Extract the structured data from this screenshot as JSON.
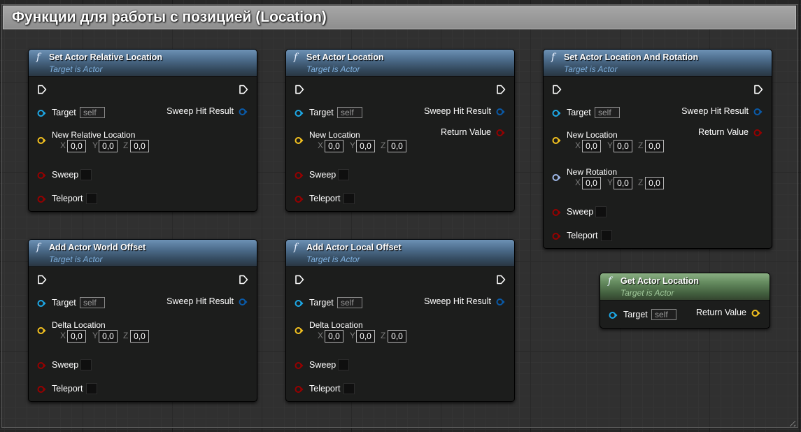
{
  "comment": {
    "title": "Функции для работы с позицией (Location)"
  },
  "colors": {
    "node_header_function": "#4e6e8e",
    "node_header_pure": "#648a5e",
    "pin_object": "#1da8e6",
    "pin_vector": "#f2c01f",
    "pin_rotator": "#9fb8e8",
    "pin_bool": "#960000",
    "pin_struct": "#0a5aa8"
  },
  "nodes": [
    {
      "id": "set-actor-relative-location",
      "title": "Set Actor Relative Location",
      "subtitle": "Target is Actor",
      "inputs": {
        "target": {
          "label": "Target",
          "value": "self"
        },
        "vector": {
          "label": "New Relative Location",
          "x": "0,0",
          "y": "0,0",
          "z": "0,0"
        },
        "sweep": {
          "label": "Sweep",
          "checked": false
        },
        "teleport": {
          "label": "Teleport",
          "checked": false
        }
      },
      "outputs": {
        "sweep_hit": "Sweep Hit Result"
      }
    },
    {
      "id": "set-actor-location",
      "title": "Set Actor Location",
      "subtitle": "Target is Actor",
      "inputs": {
        "target": {
          "label": "Target",
          "value": "self"
        },
        "vector": {
          "label": "New Location",
          "x": "0,0",
          "y": "0,0",
          "z": "0,0"
        },
        "sweep": {
          "label": "Sweep",
          "checked": false
        },
        "teleport": {
          "label": "Teleport",
          "checked": false
        }
      },
      "outputs": {
        "sweep_hit": "Sweep Hit Result",
        "return_value": "Return Value"
      }
    },
    {
      "id": "set-actor-location-and-rotation",
      "title": "Set Actor Location And Rotation",
      "subtitle": "Target is Actor",
      "inputs": {
        "target": {
          "label": "Target",
          "value": "self"
        },
        "vector": {
          "label": "New Location",
          "x": "0,0",
          "y": "0,0",
          "z": "0,0"
        },
        "rotation": {
          "label": "New Rotation",
          "x": "0,0",
          "y": "0,0",
          "z": "0,0"
        },
        "sweep": {
          "label": "Sweep",
          "checked": false
        },
        "teleport": {
          "label": "Teleport",
          "checked": false
        }
      },
      "outputs": {
        "sweep_hit": "Sweep Hit Result",
        "return_value": "Return Value"
      }
    },
    {
      "id": "add-actor-world-offset",
      "title": "Add Actor World Offset",
      "subtitle": "Target is Actor",
      "inputs": {
        "target": {
          "label": "Target",
          "value": "self"
        },
        "vector": {
          "label": "Delta Location",
          "x": "0,0",
          "y": "0,0",
          "z": "0,0"
        },
        "sweep": {
          "label": "Sweep",
          "checked": false
        },
        "teleport": {
          "label": "Teleport",
          "checked": false
        }
      },
      "outputs": {
        "sweep_hit": "Sweep Hit Result"
      }
    },
    {
      "id": "add-actor-local-offset",
      "title": "Add Actor Local Offset",
      "subtitle": "Target is Actor",
      "inputs": {
        "target": {
          "label": "Target",
          "value": "self"
        },
        "vector": {
          "label": "Delta Location",
          "x": "0,0",
          "y": "0,0",
          "z": "0,0"
        },
        "sweep": {
          "label": "Sweep",
          "checked": false
        },
        "teleport": {
          "label": "Teleport",
          "checked": false
        }
      },
      "outputs": {
        "sweep_hit": "Sweep Hit Result"
      }
    },
    {
      "id": "get-actor-location",
      "title": "Get Actor Location",
      "subtitle": "Target is Actor",
      "inputs": {
        "target": {
          "label": "Target",
          "value": "self"
        }
      },
      "outputs": {
        "return_value": "Return Value"
      }
    }
  ],
  "axis_labels": {
    "x": "X",
    "y": "Y",
    "z": "Z"
  }
}
